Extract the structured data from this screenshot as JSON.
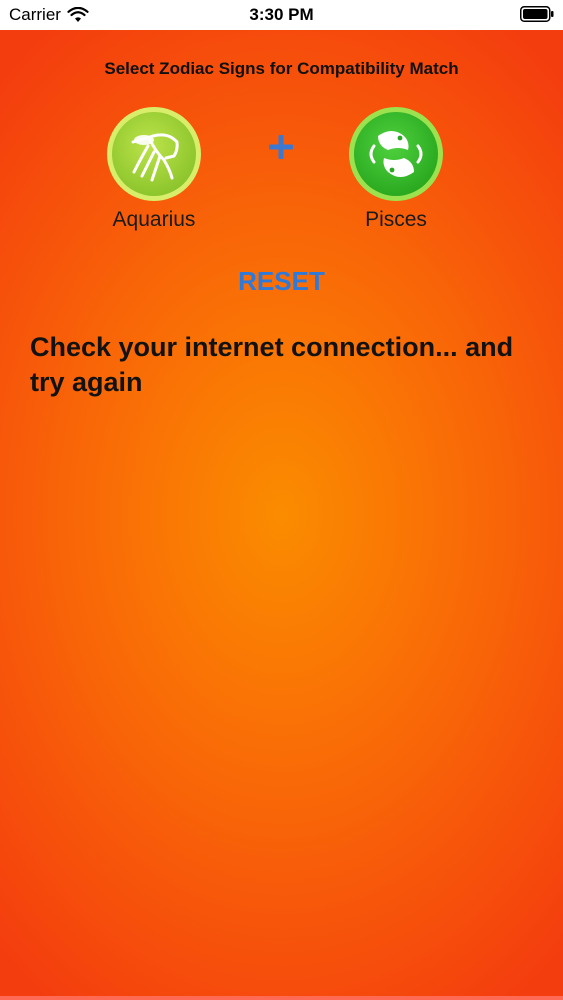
{
  "status_bar": {
    "carrier": "Carrier",
    "time": "3:30 PM"
  },
  "header": {
    "title": "Select Zodiac Signs for Compatibility Match"
  },
  "signs": [
    {
      "label": "Aquarius",
      "icon": "aquarius-icon",
      "color": "#a3d43a"
    },
    {
      "label": "Pisces",
      "icon": "pisces-icon",
      "color": "#3cbf2e"
    }
  ],
  "actions": {
    "reset_label": "RESET"
  },
  "message": {
    "text": "Check your internet connection... and try again"
  },
  "colors": {
    "accent": "#2f7ad8",
    "background_center": "#fb8c00",
    "background_edge": "#f43d0e"
  }
}
